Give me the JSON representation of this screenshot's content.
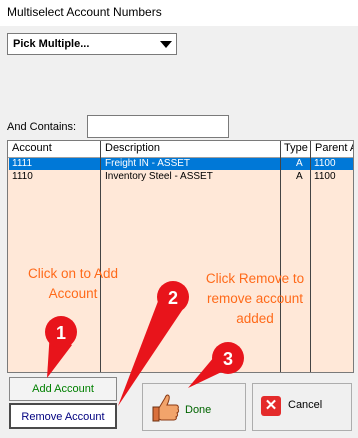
{
  "window": {
    "title": "Multiselect Account Numbers"
  },
  "filter": {
    "dropdown_value": "Pick Multiple...",
    "contains_label": "And Contains:",
    "contains_value": ""
  },
  "grid": {
    "columns": [
      "Account",
      "Description",
      "Type",
      "Parent A"
    ],
    "rows": [
      {
        "account": "1111",
        "description": "Freight IN - ASSET",
        "type": "A",
        "parent": "1100",
        "selected": true
      },
      {
        "account": "1110",
        "description": "Inventory Steel - ASSET",
        "type": "A",
        "parent": "1100",
        "selected": false
      }
    ]
  },
  "buttons": {
    "add": "Add Account",
    "remove": "Remove Account",
    "done": "Done",
    "cancel": "Cancel"
  },
  "annotations": {
    "left_text_1": "Click on to Add",
    "left_text_2": "Account",
    "right_text_1": "Click Remove to",
    "right_text_2": "remove account",
    "right_text_3": "added",
    "callout_1": "1",
    "callout_2": "2",
    "callout_3": "3",
    "annotation_color": "#ff6a1a",
    "callout_color": "#e8141b"
  },
  "colors": {
    "grid_background": "#ffe8d8",
    "selection": "#0078d7"
  }
}
